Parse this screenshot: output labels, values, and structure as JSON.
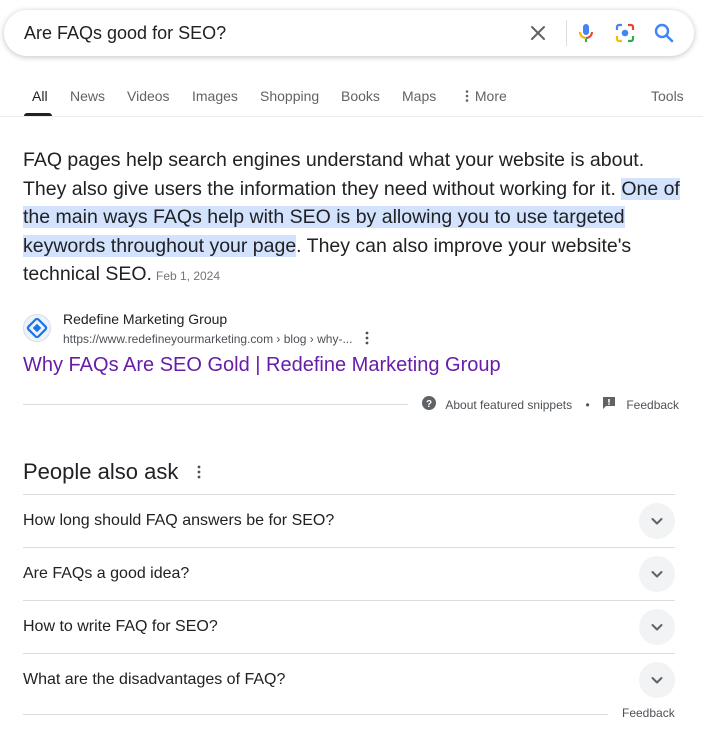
{
  "search": {
    "query": "Are FAQs good for SEO?",
    "clear_icon": "close-icon",
    "voice_icon": "microphone-icon",
    "lens_icon": "camera-lens-icon",
    "search_icon": "search-icon"
  },
  "tabs": {
    "items": [
      {
        "label": "All",
        "active": true
      },
      {
        "label": "News"
      },
      {
        "label": "Videos"
      },
      {
        "label": "Images"
      },
      {
        "label": "Shopping"
      },
      {
        "label": "Books"
      },
      {
        "label": "Maps"
      },
      {
        "label": "More"
      }
    ],
    "tools": "Tools"
  },
  "snippet": {
    "text_before": "FAQ pages help search engines understand what your website is about. They also give users the information they need without working for it. ",
    "highlight": "One of the main ways FAQs help with SEO is by allowing you to use targeted keywords throughout your page",
    "text_after": ". They can also improve your website's technical SEO.",
    "date": "Feb 1, 2024"
  },
  "source": {
    "site_name": "Redefine Marketing Group",
    "url": "https://www.redefineyourmarketing.com › blog › why-...",
    "title": "Why FAQs Are SEO Gold | Redefine Marketing Group"
  },
  "snippet_footer": {
    "about": "About featured snippets",
    "dot": "•",
    "feedback": "Feedback"
  },
  "paa": {
    "title": "People also ask",
    "questions": [
      "How long should FAQ answers be for SEO?",
      "Are FAQs a good idea?",
      "How to write FAQ for SEO?",
      "What are the disadvantages of FAQ?"
    ],
    "feedback": "Feedback"
  },
  "colors": {
    "link_visited": "#681da8",
    "highlight": "#d3e3fd",
    "accent_blue": "#4285f4"
  }
}
